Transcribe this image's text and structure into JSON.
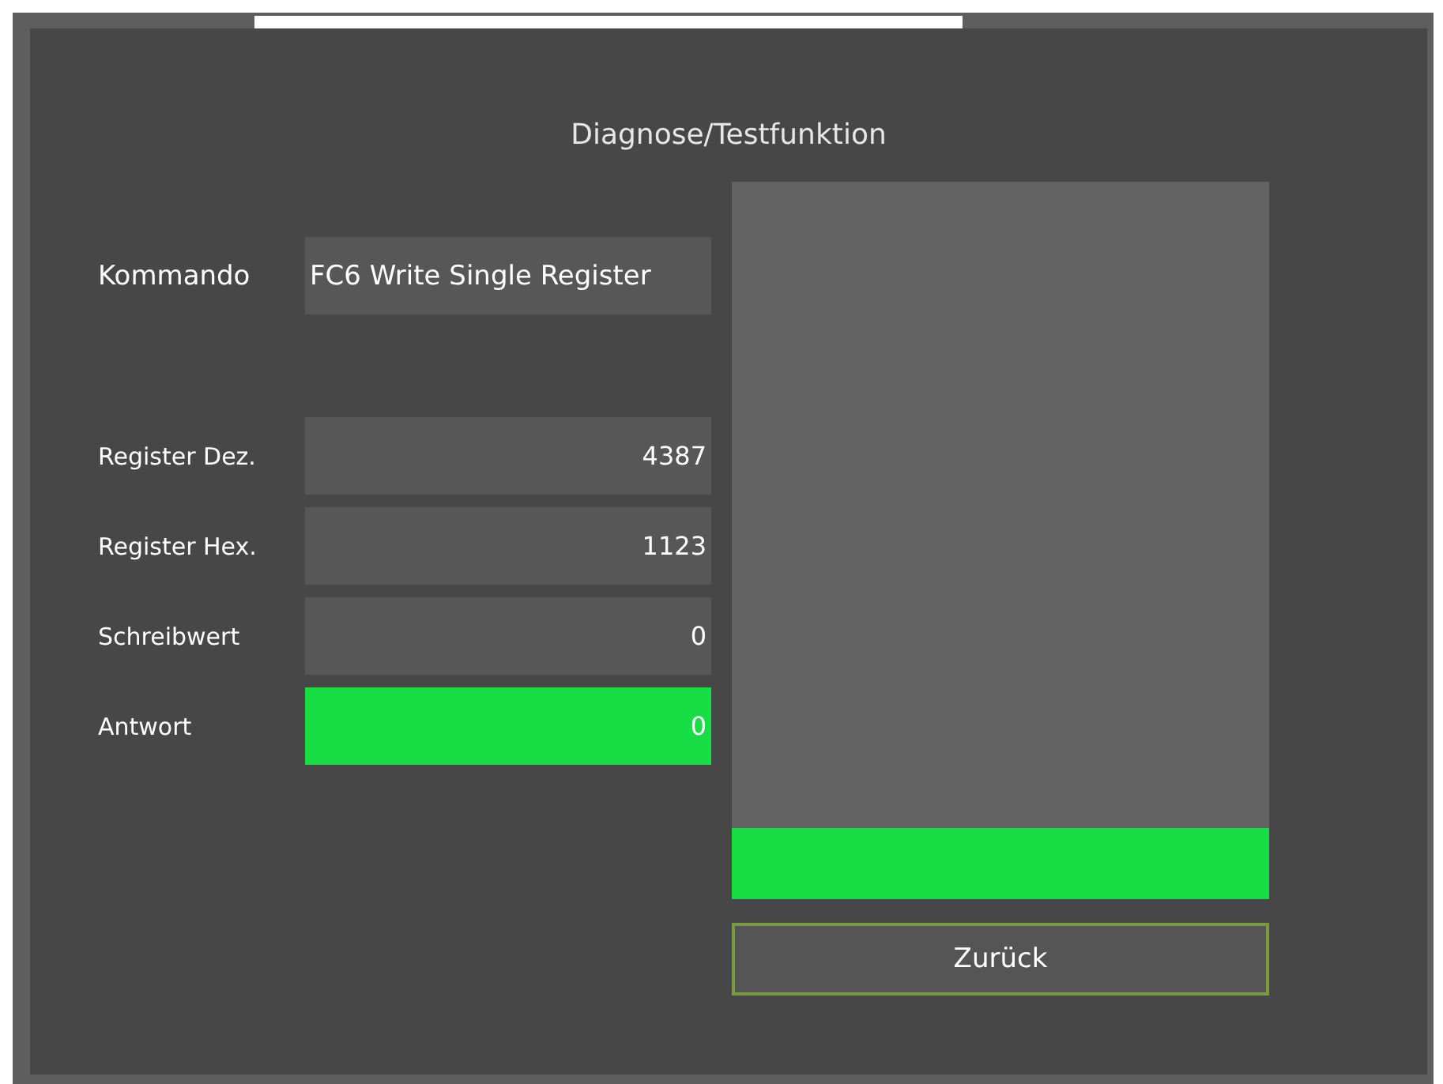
{
  "title": "Diagnose/Testfunktion",
  "command": {
    "label": "Kommando",
    "value": "FC6 Write Single Register"
  },
  "fields": [
    {
      "label": "Register Dez.",
      "value": "4387",
      "highlighted": false
    },
    {
      "label": "Register Hex.",
      "value": "1123",
      "highlighted": false
    },
    {
      "label": "Schreibwert",
      "value": "0",
      "highlighted": false
    },
    {
      "label": "Antwort",
      "value": "0",
      "highlighted": true
    }
  ],
  "status_bar": {
    "on": true
  },
  "back_button": {
    "label": "Zurück"
  }
}
